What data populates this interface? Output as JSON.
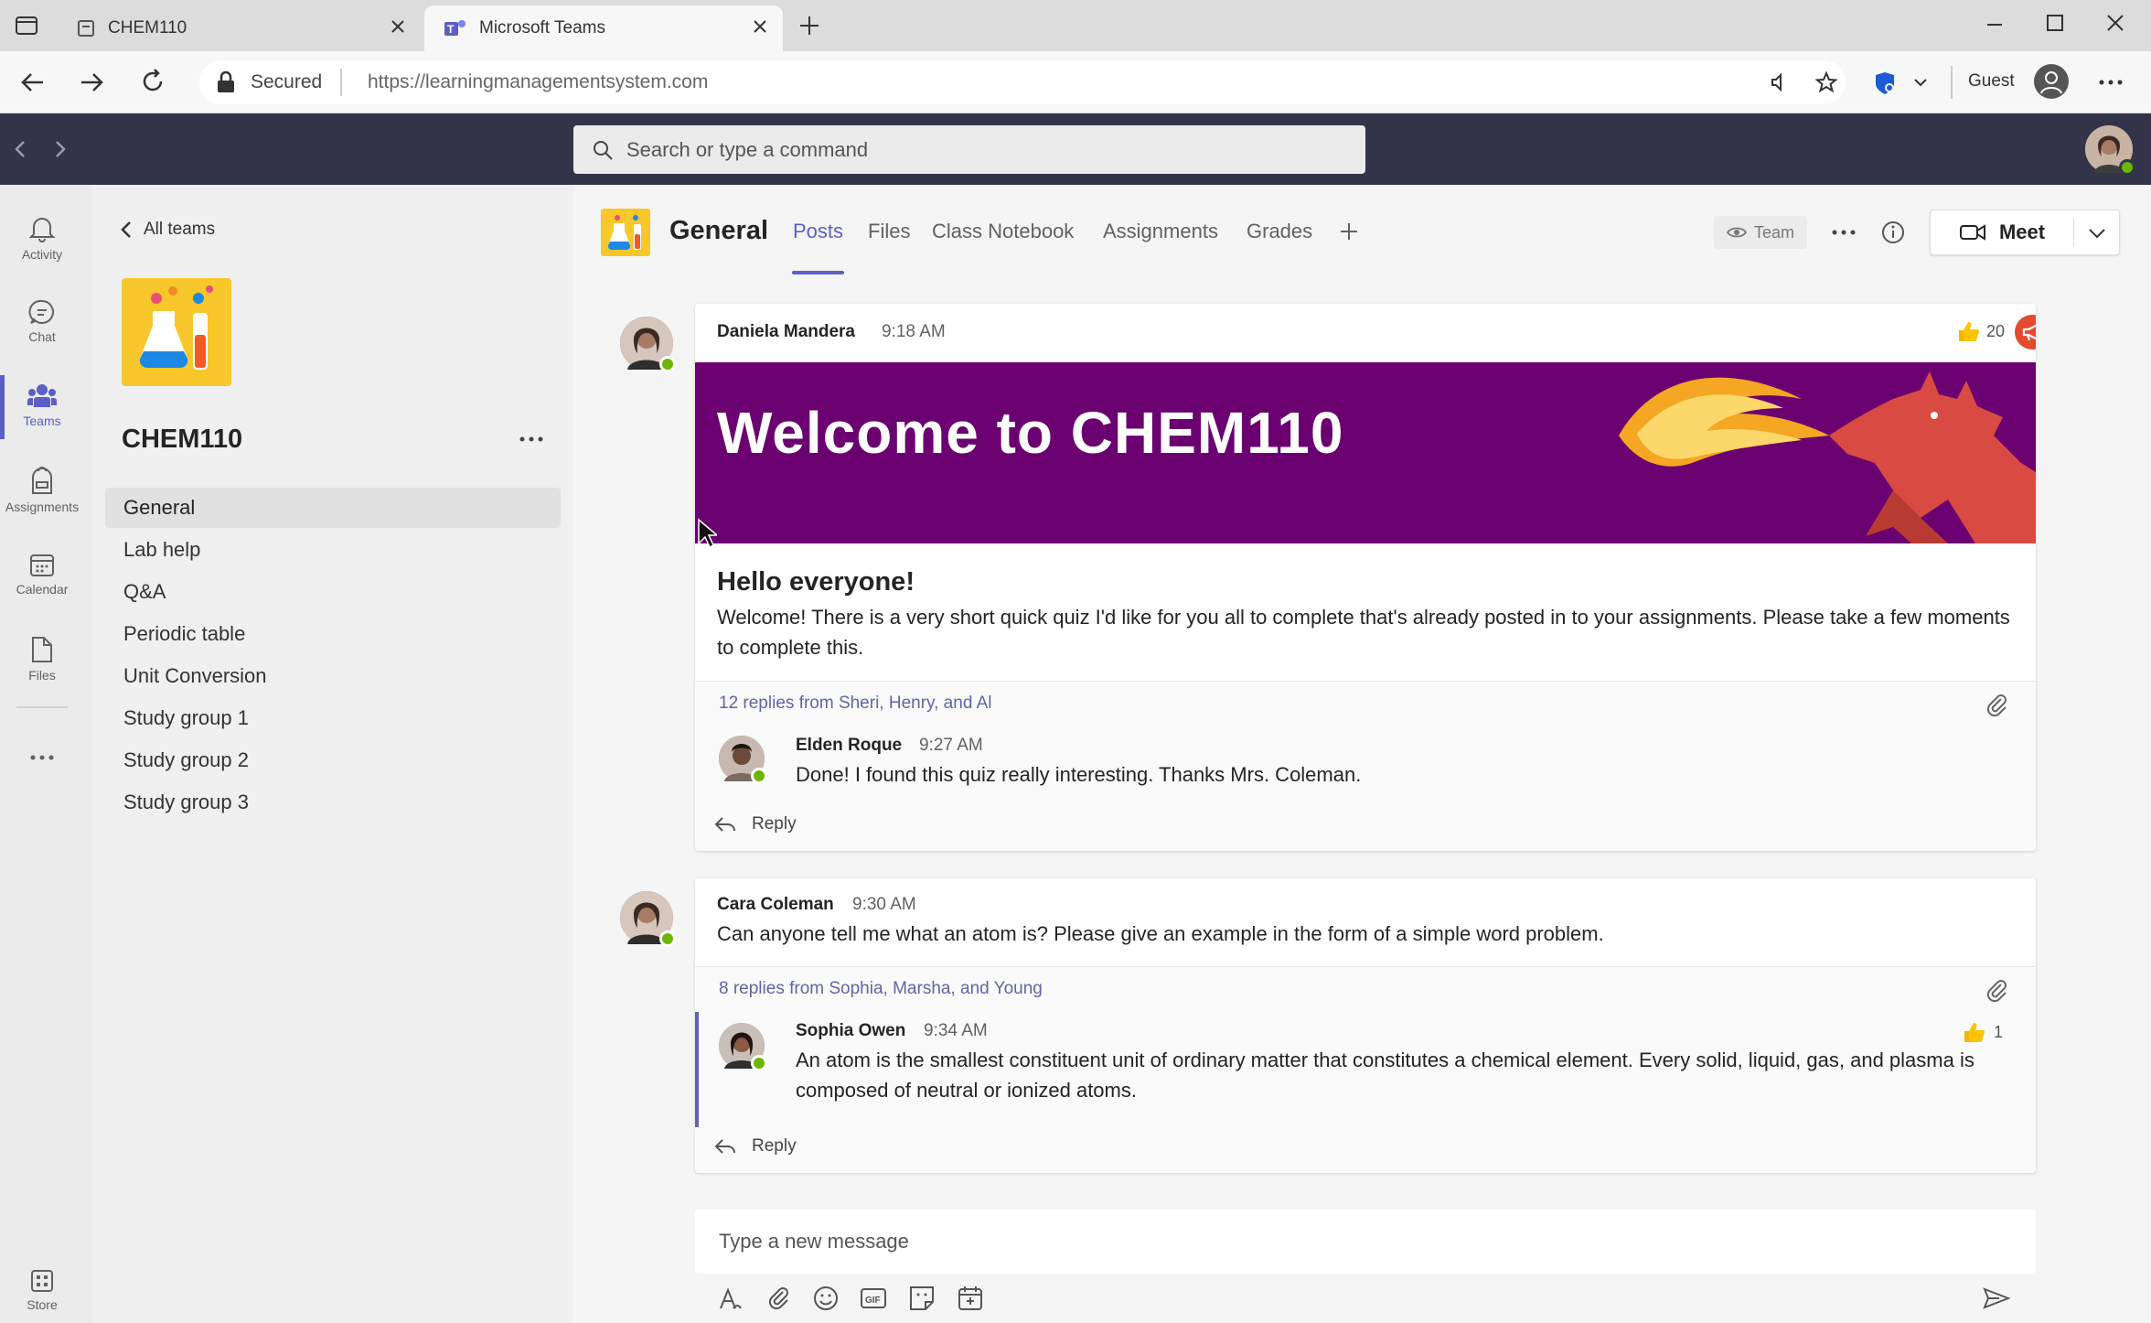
{
  "browser": {
    "tabs": [
      {
        "title": "CHEM110"
      },
      {
        "title": "Microsoft Teams"
      }
    ],
    "security_label": "Secured",
    "url": "https://learningmanagementsystem.com",
    "profile_label": "Guest"
  },
  "teams_header": {
    "search_placeholder": "Search or type a command"
  },
  "rail": {
    "items": [
      {
        "label": "Activity",
        "icon": "bell-icon"
      },
      {
        "label": "Chat",
        "icon": "chat-icon"
      },
      {
        "label": "Teams",
        "icon": "teams-icon"
      },
      {
        "label": "Assignments",
        "icon": "backpack-icon"
      },
      {
        "label": "Calendar",
        "icon": "calendar-icon"
      },
      {
        "label": "Files",
        "icon": "file-icon"
      },
      {
        "label": "Store",
        "icon": "store-icon"
      }
    ]
  },
  "channel_panel": {
    "back_label": "All teams",
    "team_name": "CHEM110",
    "channels": [
      "General",
      "Lab help",
      "Q&A",
      "Periodic table",
      "Unit Conversion",
      "Study group 1",
      "Study group 2",
      "Study group 3"
    ]
  },
  "channel_header": {
    "title": "General",
    "tabs": [
      "Posts",
      "Files",
      "Class Notebook",
      "Assignments",
      "Grades"
    ],
    "team_label": "Team",
    "meet_label": "Meet"
  },
  "posts": [
    {
      "author": "Daniela Mandera",
      "time": "9:18 AM",
      "like_count": "20",
      "banner_text": "Welcome to CHEM110",
      "heading": "Hello everyone!",
      "body": "Welcome! There is a very short quick quiz I'd like for you all to complete that's already posted in to your assignments. Please take a few moments to complete this.",
      "replies_summary": "12 replies from Sheri, Henry, and Al",
      "reply": {
        "author": "Elden Roque",
        "time": "9:27 AM",
        "body": "Done! I found this quiz really interesting. Thanks Mrs. Coleman."
      },
      "reply_label": "Reply"
    },
    {
      "author": "Cara Coleman",
      "time": "9:30 AM",
      "body": "Can anyone tell me what an atom is? Please give an example in the form of a simple word problem.",
      "replies_summary": "8 replies from Sophia, Marsha, and Young",
      "reply": {
        "author": "Sophia Owen",
        "time": "9:34 AM",
        "like_count": "1",
        "body": "An atom is the smallest constituent unit of ordinary matter that constitutes a chemical element. Every solid, liquid, gas, and plasma is composed of neutral or ionized atoms."
      },
      "reply_label": "Reply"
    }
  ],
  "composer": {
    "placeholder": "Type a new message"
  },
  "colors": {
    "accent": "#5b5fc7",
    "header": "#33344a",
    "banner": "#6b0070"
  }
}
